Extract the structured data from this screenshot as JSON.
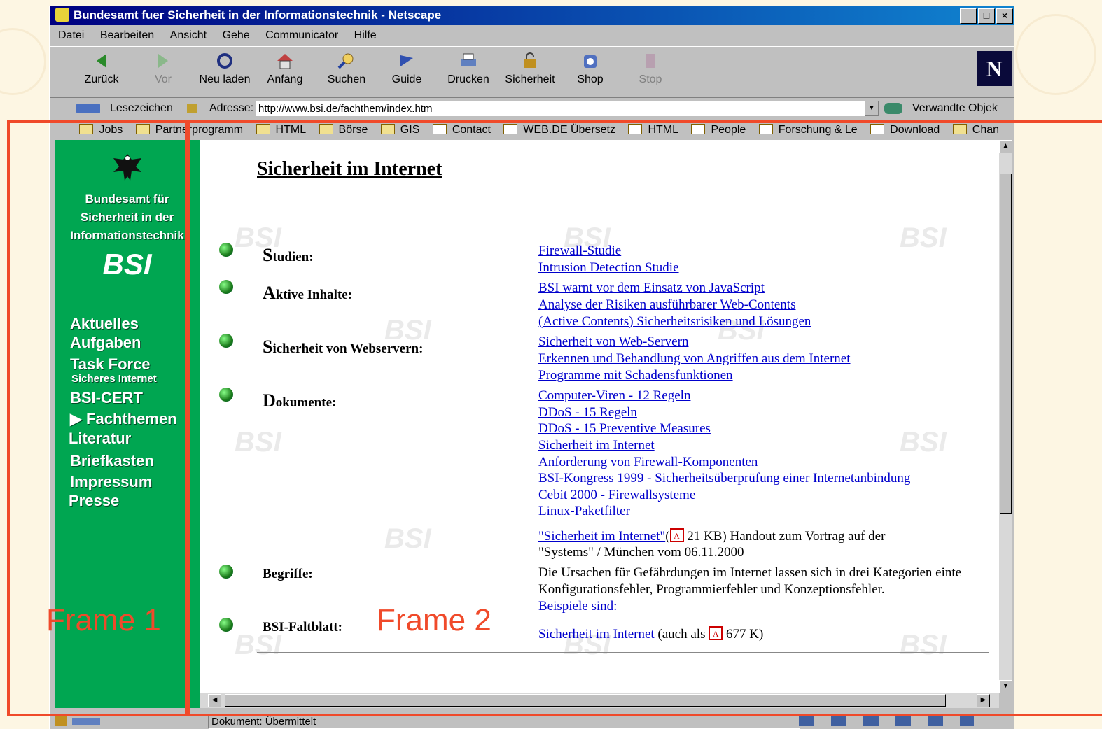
{
  "window": {
    "title": "Bundesamt fuer Sicherheit in der Informationstechnik - Netscape",
    "controls": [
      "_",
      "□",
      "×"
    ]
  },
  "menu": [
    "Datei",
    "Bearbeiten",
    "Ansicht",
    "Gehe",
    "Communicator",
    "Hilfe"
  ],
  "toolbar": [
    {
      "label": "Zurück",
      "icon": "back-arrow-icon",
      "enabled": true
    },
    {
      "label": "Vor",
      "icon": "forward-arrow-icon",
      "enabled": false
    },
    {
      "label": "Neu laden",
      "icon": "reload-icon",
      "enabled": true
    },
    {
      "label": "Anfang",
      "icon": "home-icon",
      "enabled": true
    },
    {
      "label": "Suchen",
      "icon": "search-icon",
      "enabled": true
    },
    {
      "label": "Guide",
      "icon": "guide-icon",
      "enabled": true
    },
    {
      "label": "Drucken",
      "icon": "print-icon",
      "enabled": true
    },
    {
      "label": "Sicherheit",
      "icon": "lock-icon",
      "enabled": true
    },
    {
      "label": "Shop",
      "icon": "shop-icon",
      "enabled": true
    },
    {
      "label": "Stop",
      "icon": "stop-icon",
      "enabled": false
    }
  ],
  "logo_letter": "N",
  "location": {
    "bookmarks_label": "Lesezeichen",
    "address_label": "Adresse:",
    "url": "http://www.bsi.de/fachthem/index.htm",
    "related_label": "Verwandte Objek"
  },
  "bookmarks": [
    "Jobs",
    "Partnerprogramm",
    "HTML",
    "Börse",
    "GIS",
    "Contact",
    "WEB.DE Übersetz",
    "HTML",
    "People",
    "Forschung & Le",
    "Download",
    "Chan"
  ],
  "sidebar": {
    "agency_lines": [
      "Bundesamt für",
      "Sicherheit in der",
      "Informationstechnik"
    ],
    "brand": "BSI",
    "nav": {
      "aktuelles": "Aktuelles",
      "aufgaben": "Aufgaben",
      "taskforce": "Task Force",
      "taskforce_sub": "Sicheres Internet",
      "bsicert": "BSI-CERT",
      "fachthemen": "Fachthemen",
      "literatur": "Literatur",
      "briefkasten": "Briefkasten",
      "impressum": "Impressum",
      "presse": "Presse"
    }
  },
  "content": {
    "title": "Sicherheit im Internet",
    "studien": {
      "initial": "S",
      "rest": "tudien:"
    },
    "aktive": {
      "initial": "A",
      "rest": "ktive Inhalte:"
    },
    "webserver": {
      "initial": "S",
      "rest": "icherheit von Webservern:"
    },
    "dokumente": {
      "initial": "D",
      "rest": "okumente:"
    },
    "begriffe": "Begriffe:",
    "faltblatt": "BSI-Faltblatt:",
    "links": {
      "firewall_studie": "Firewall-Studie",
      "ids_studie": "Intrusion Detection Studie",
      "javascript": "BSI warnt vor dem Einsatz von JavaScript",
      "risiken": "Analyse der Risiken ausführbarer Web-Contents",
      "active": "(Active Contents) Sicherheitsrisiken und Lösungen",
      "webserver_sicherheit": "Sicherheit von Web-Servern",
      "angriffe": "Erkennen und Behandlung von Angriffen aus dem Internet",
      "schadensfunktionen": "Programme mit Schadensfunktionen",
      "viren": "Computer-Viren - 12 Regeln",
      "ddos_de": "DDoS - 15 Regeln",
      "ddos_en": "DDoS - 15 Preventive Measures",
      "sicherheit_internet": "Sicherheit im Internet",
      "anforderung": "Anforderung von Firewall-Komponenten",
      "kongress": "BSI-Kongress 1999 - Sicherheitsüberprüfung einer Internetanbindung",
      "cebit": "Cebit 2000 - Firewallsysteme",
      "linux": "Linux-Paketfilter",
      "handout": "\"Sicherheit im Internet\"",
      "beispiele": "Beispiele sind:",
      "faltblatt_link": "Sicherheit im Internet"
    },
    "texts": {
      "handout_open": "(",
      "handout_size": " 21 KB) Handout zum Vortrag auf der",
      "handout_line2": "\"Systems\" / München vom 06.11.2000",
      "begriffe_line1": "Die Ursachen für Gefährdungen im Internet lassen sich in drei Kategorien einte",
      "begriffe_line2": "Konfigurationsfehler, Programmierfehler und Konzeptionsfehler.",
      "faltblatt_mid": " (auch als ",
      "faltblatt_size": " 677 K)"
    },
    "watermark": "BSI"
  },
  "status": {
    "text": "Dokument: Übermittelt"
  },
  "annotations": {
    "frame1": "Frame 1",
    "frame2": "Frame 2",
    "color": "#f04a2a"
  },
  "colors": {
    "sidebar": "#00a651",
    "link": "#0000cc",
    "titlebar": "#000080"
  }
}
